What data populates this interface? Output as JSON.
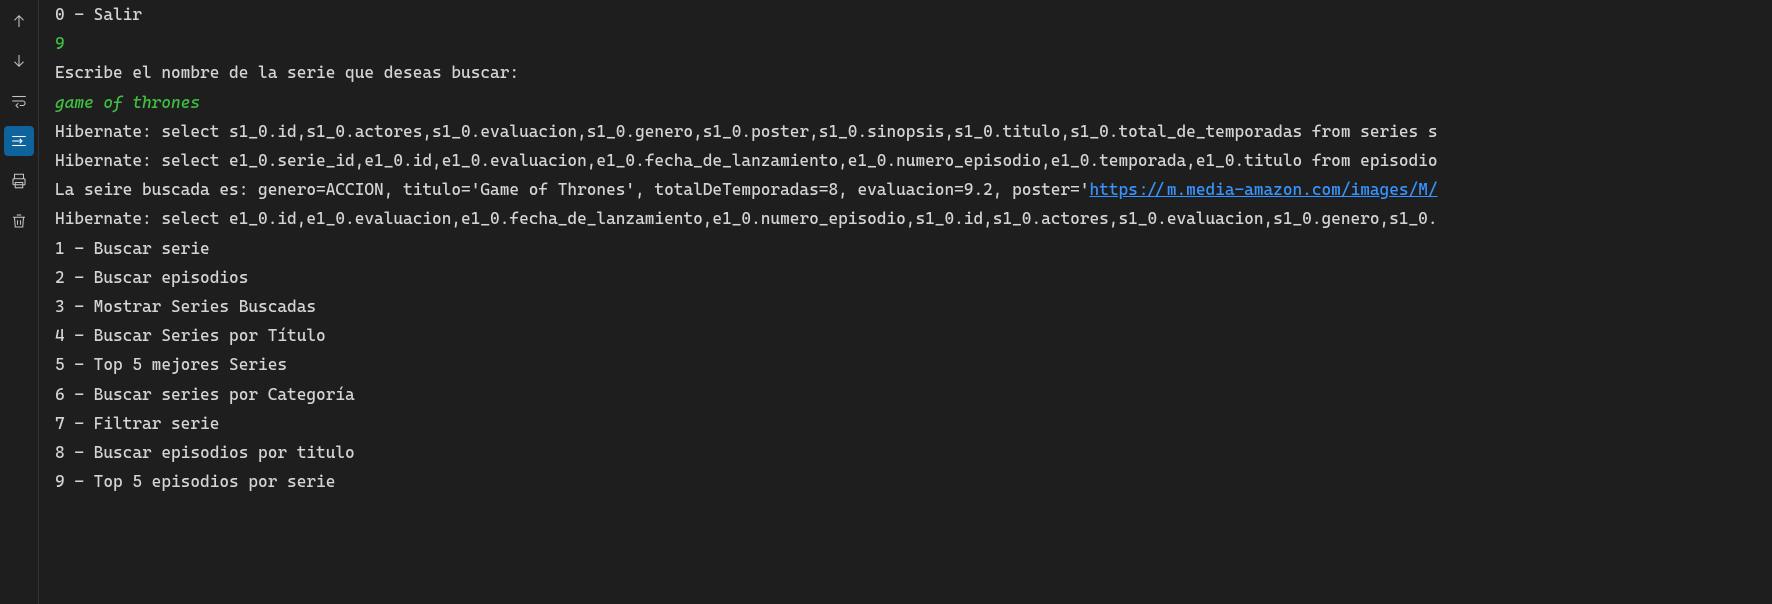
{
  "sidebar": {
    "up_icon": "arrow-up",
    "down_icon": "arrow-down",
    "wrap_icon": "word-wrap",
    "scroll_lock_icon": "scroll-lock",
    "print_icon": "print",
    "trash_icon": "trash"
  },
  "console": {
    "line_top": "0 - Salir",
    "blank": "",
    "input_number": "9",
    "prompt_series": "Escribe el nombre de la serie que deseas buscar:",
    "input_series": "game of thrones",
    "hibernate1": "Hibernate: select s1_0.id,s1_0.actores,s1_0.evaluacion,s1_0.genero,s1_0.poster,s1_0.sinopsis,s1_0.titulo,s1_0.total_de_temporadas from series s",
    "hibernate2": "Hibernate: select e1_0.serie_id,e1_0.id,e1_0.evaluacion,e1_0.fecha_de_lanzamiento,e1_0.numero_episodio,e1_0.temporada,e1_0.titulo from episodio",
    "result_prefix": "La seire buscada es: genero=ACCION, titulo='Game of Thrones', totalDeTemporadas=8, evaluacion=9.2, poster='",
    "result_link": "https://m.media-amazon.com/images/M/",
    "hibernate3": "Hibernate: select e1_0.id,e1_0.evaluacion,e1_0.fecha_de_lanzamiento,e1_0.numero_episodio,s1_0.id,s1_0.actores,s1_0.evaluacion,s1_0.genero,s1_0.",
    "menu": [
      "1 - Buscar serie",
      "2 - Buscar episodios",
      "3 - Mostrar Series Buscadas",
      "4 - Buscar Series por Título",
      "5 - Top 5 mejores Series",
      "6 - Buscar series por Categoría",
      "7 - Filtrar serie",
      "8 - Buscar episodios por titulo",
      "9 - Top 5 episodios por serie"
    ]
  }
}
